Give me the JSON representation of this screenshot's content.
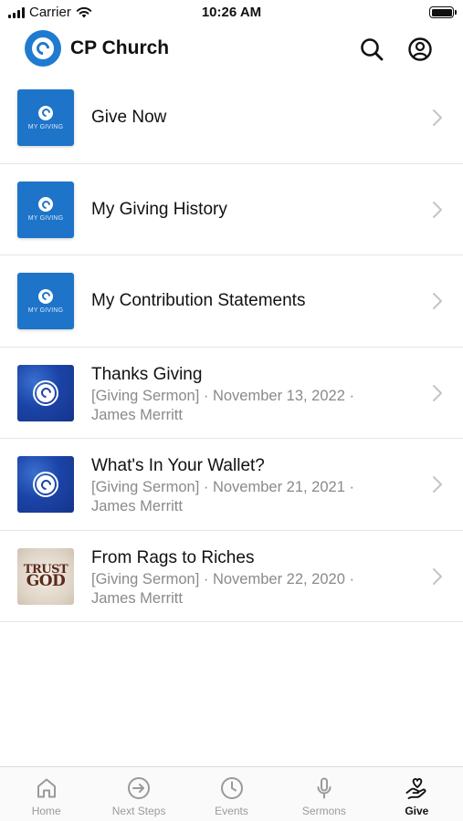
{
  "status_bar": {
    "carrier": "Carrier",
    "time": "10:26 AM"
  },
  "header": {
    "title": "CP Church",
    "brand_color": "#1f7bd0"
  },
  "list": {
    "items": [
      {
        "title": "Give Now",
        "thumb_caption": "MY GIVING"
      },
      {
        "title": "My Giving History",
        "thumb_caption": "MY GIVING"
      },
      {
        "title": "My Contribution Statements",
        "thumb_caption": "MY GIVING"
      },
      {
        "title": "Thanks Giving",
        "subtitle_line1": "[Giving Sermon] · November 13, 2022 ·",
        "subtitle_line2": "James Merritt"
      },
      {
        "title": "What's In Your Wallet?",
        "subtitle_line1": "[Giving Sermon] · November 21, 2021 ·",
        "subtitle_line2": "James Merritt"
      },
      {
        "title": "From Rags to Riches",
        "subtitle_line1": "[Giving Sermon] · November 22, 2020 ·",
        "subtitle_line2": "James Merritt",
        "thumb_text_1": "TRUST",
        "thumb_text_2": "GOD"
      }
    ]
  },
  "tabbar": {
    "tabs": [
      {
        "label": "Home",
        "icon": "home-icon"
      },
      {
        "label": "Next Steps",
        "icon": "arrow-circle-icon"
      },
      {
        "label": "Events",
        "icon": "clock-icon"
      },
      {
        "label": "Sermons",
        "icon": "microphone-icon"
      },
      {
        "label": "Give",
        "icon": "give-heart-icon",
        "active": true
      }
    ]
  }
}
